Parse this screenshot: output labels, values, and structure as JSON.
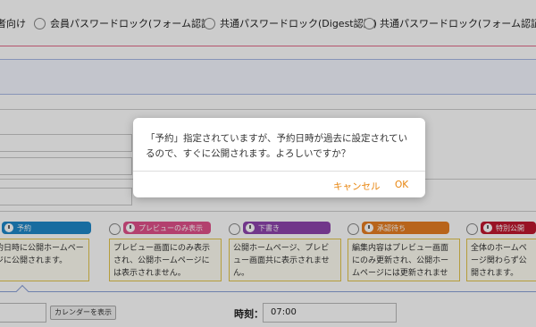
{
  "top_radios": [
    {
      "label": "者向け"
    },
    {
      "label": "会員パスワードロック(フォーム認証)"
    },
    {
      "label": "共通パスワードロック(Digest認証)"
    },
    {
      "label": "共通パスワードロック(フォーム認証)"
    }
  ],
  "statuses": [
    {
      "badge": "予約",
      "color": "#1e88c8",
      "desc": "約日時に公開ホームページに公開されます。"
    },
    {
      "badge": "プレビューのみ表示",
      "color": "#e0508a",
      "desc": "プレビュー画面にのみ表示され、公開ホームページには表示されません。"
    },
    {
      "badge": "下書き",
      "color": "#8e44ad",
      "desc": "公開ホームページ、プレビュー画面共に表示されません。"
    },
    {
      "badge": "承認待ち",
      "color": "#e67e22",
      "desc": "編集内容はプレビュー画面にのみ更新され、公開ホームページには更新されません。"
    },
    {
      "badge": "特別公開",
      "color": "#c0182f",
      "desc": "全体のホームページ関わらず公開されます。"
    }
  ],
  "schedule": {
    "calendar_button": "カレンダーを表示",
    "time_label": "時刻：",
    "time_value": "07:00"
  },
  "dialog": {
    "message": "「予約」指定されていますが、予約日時が過去に設定されているので、すぐに公開されます。よろしいですか？",
    "cancel": "キャンセル",
    "ok": "OK",
    "accent_color": "#e8850e"
  }
}
